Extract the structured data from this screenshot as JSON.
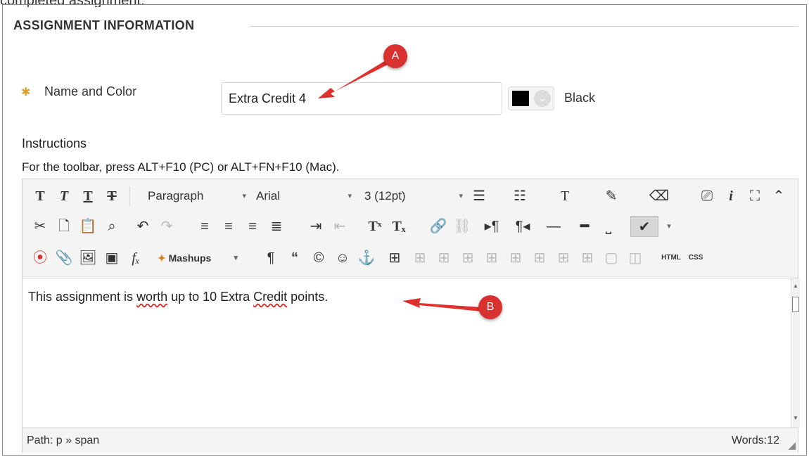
{
  "top_cut_text": "completed assignment.",
  "section": {
    "title": "ASSIGNMENT INFORMATION"
  },
  "name_field": {
    "label": "Name and Color",
    "value": "Extra Credit 4",
    "color_name": "Black",
    "swatch_color": "#000000"
  },
  "instructions": {
    "label": "Instructions",
    "toolbar_hint": "For the toolbar, press ALT+F10 (PC) or ALT+FN+F10 (Mac)."
  },
  "toolbar": {
    "format_select": "Paragraph",
    "font_select": "Arial",
    "size_select": "3 (12pt)",
    "mashups_select": "Mashups",
    "html_label": "HTML",
    "css_label": "CSS"
  },
  "editor": {
    "text_before": "This assignment is ",
    "word1": "worth",
    "text_mid": " up to 10 Extra ",
    "word2": "Credit",
    "text_after": " points.",
    "path": "Path: p » span",
    "word_count": "Words:12"
  },
  "callouts": {
    "a": "A",
    "b": "B"
  },
  "colors": {
    "callout": "#d93030",
    "accent_star": "#e0a030"
  }
}
